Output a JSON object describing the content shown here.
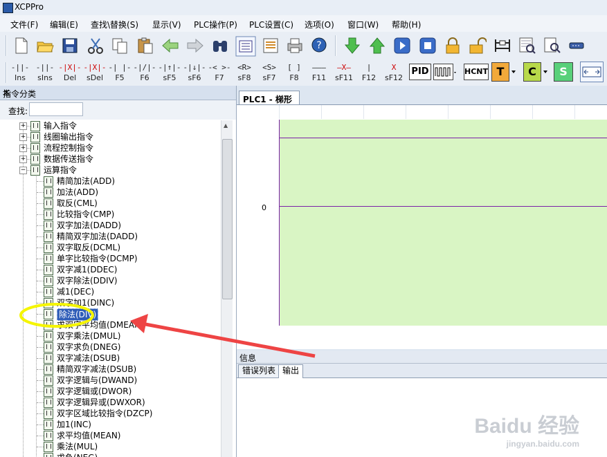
{
  "app": {
    "title": "XCPPro"
  },
  "menu": [
    "文件(F)",
    "编辑(E)",
    "查找\\替换(S)",
    "显示(V)",
    "PLC操作(P)",
    "PLC设置(C)",
    "选项(O)",
    "窗口(W)",
    "帮助(H)"
  ],
  "ladder_toolbar": [
    {
      "sym": "-||-",
      "label": "Ins"
    },
    {
      "sym": "-||-",
      "label": "sIns"
    },
    {
      "sym": "-|X|-",
      "label": "Del"
    },
    {
      "sym": "-|X|-",
      "label": "sDel"
    },
    {
      "sym": "-| |-",
      "label": "F5"
    },
    {
      "sym": "-|/|-",
      "label": "F6"
    },
    {
      "sym": "-|↑|-",
      "label": "sF5"
    },
    {
      "sym": "-|↓|-",
      "label": "sF6"
    },
    {
      "sym": "-< >-",
      "label": "F7"
    },
    {
      "sym": "<R>",
      "label": "sF8"
    },
    {
      "sym": "<S>",
      "label": "sF7"
    },
    {
      "sym": "[ ]",
      "label": "F8"
    },
    {
      "sym": "———",
      "label": "F11"
    },
    {
      "sym": "—X—",
      "label": "sF11"
    },
    {
      "sym": "|",
      "label": "F12"
    },
    {
      "sym": "X",
      "label": "sF12"
    }
  ],
  "box_buttons": {
    "pid": "PID",
    "hcnt": "HCNT",
    "t": "T",
    "c": "C",
    "s": "S"
  },
  "left_panel": {
    "title": "指令分类",
    "pin": "⊥",
    "close": "✕",
    "search_label": "查找:",
    "search_value": "",
    "categories": [
      "输入指令",
      "线圈输出指令",
      "流程控制指令",
      "数据传送指令",
      "运算指令"
    ],
    "expanders": [
      "+",
      "+",
      "+",
      "+",
      "−"
    ],
    "items": [
      "精简加法(ADD)",
      "加法(ADD)",
      "取反(CML)",
      "比较指令(CMP)",
      "双字加法(DADD)",
      "精简双字加法(DADD)",
      "双字取反(DCML)",
      "单字比较指令(DCMP)",
      "双字减1(DDEC)",
      "双字除法(DDIV)",
      "减1(DEC)",
      "双字加1(DINC)",
      "除法(DIV)",
      "求双字平均值(DMEAN)",
      "双字乘法(DMUL)",
      "双字求负(DNEG)",
      "双字减法(DSUB)",
      "精简双字减法(DSUB)",
      "双字逻辑与(DWAND)",
      "双字逻辑或(DWOR)",
      "双字逻辑异或(DWXOR)",
      "双字区域比较指令(DZCP)",
      "加1(INC)",
      "求平均值(MEAN)",
      "乘法(MUL)",
      "求负(NEG)"
    ],
    "selected_index": 12
  },
  "ladder": {
    "tab": "PLC1 - 梯形图",
    "row_number": "0"
  },
  "info": {
    "title": "信息",
    "tabs": [
      "错误列表",
      "输出"
    ],
    "active_tab": 1
  },
  "watermark": {
    "logo": "Baidu 经验",
    "url": "jingyan.baidu.com"
  },
  "colors": {
    "ladder_bg": "#d9f5c4",
    "rung": "#7a1fa8",
    "annotation_circle": "#f5f500",
    "annotation_arrow": "#ee4444",
    "selected": "#2f5db8"
  }
}
